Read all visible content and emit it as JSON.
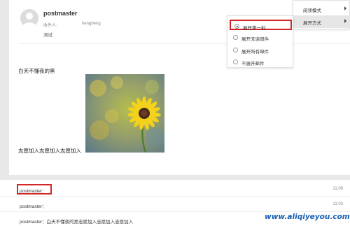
{
  "message": {
    "sender": "postmaster",
    "recipient_label": "收件人：",
    "recipient": "hengbeng",
    "subject": "测试",
    "body_heading": "白天不懂夜的黑",
    "body_line": "志愿加入志愿加入志愿加入"
  },
  "menu": {
    "items": [
      {
        "label": "阅读模式",
        "has_submenu": true
      },
      {
        "label": "展开方式",
        "has_submenu": true,
        "hovered": true
      }
    ]
  },
  "submenu": {
    "items": [
      {
        "label": "展开第一封",
        "selected": true
      },
      {
        "label": "展开未读邮件",
        "selected": false
      },
      {
        "label": "展开所有邮件",
        "selected": false
      },
      {
        "label": "不展开邮件",
        "selected": false
      }
    ]
  },
  "conversation": [
    {
      "text": "postmaster：",
      "time": "11:06",
      "highlighted": true
    },
    {
      "text": "postmaster：",
      "time": "11:03"
    },
    {
      "text": "postmaster：白天不懂夜的黑志愿加入志愿加入志愿加入",
      "time": ""
    }
  ],
  "watermark": "www.aliqiyeyou.com",
  "colors": {
    "highlight_border": "#d42626",
    "watermark": "#1a5fb4",
    "background_gray": "#e8e8e8"
  },
  "icons": [
    "avatar-placeholder",
    "chevron-right-icon",
    "radio-icon"
  ]
}
